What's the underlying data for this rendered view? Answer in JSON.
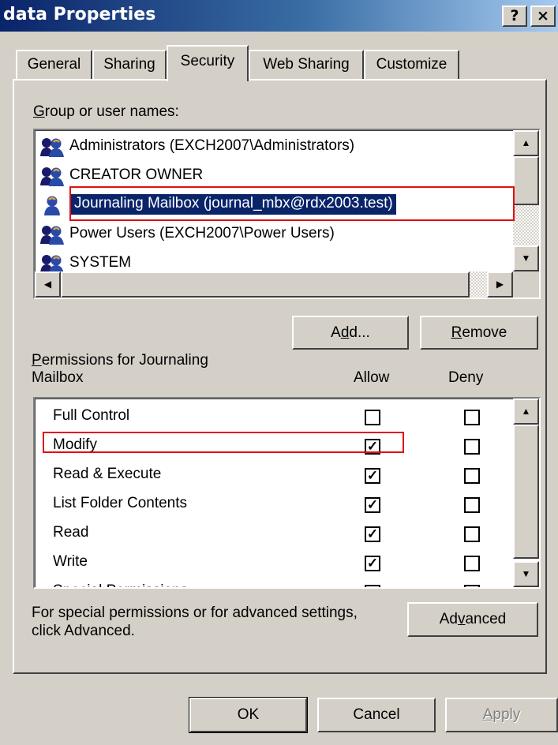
{
  "window": {
    "title": "data Properties",
    "help_btn": "?",
    "close_btn": "×"
  },
  "tabs": [
    {
      "label": "General",
      "active": false
    },
    {
      "label": "Sharing",
      "active": false
    },
    {
      "label": "Security",
      "active": true
    },
    {
      "label": "Web Sharing",
      "active": false
    },
    {
      "label": "Customize",
      "active": false
    }
  ],
  "groups": {
    "label_access_key": "G",
    "label_rest": "roup or user names:",
    "items": [
      {
        "name": "Administrators (EXCH2007\\Administrators)",
        "icon": "group-users-icon",
        "selected": false
      },
      {
        "name": "CREATOR OWNER",
        "icon": "group-users-icon",
        "selected": false
      },
      {
        "name": "Journaling Mailbox (journal_mbx@rdx2003.test)",
        "icon": "single-user-icon",
        "selected": true
      },
      {
        "name": "Power Users (EXCH2007\\Power Users)",
        "icon": "group-users-icon",
        "selected": false
      },
      {
        "name": "SYSTEM",
        "icon": "group-users-icon",
        "selected": false
      }
    ]
  },
  "buttons": {
    "add_pre": "A",
    "add_key": "d",
    "add_post": "d...",
    "remove_key": "R",
    "remove_post": "emove",
    "advanced_pre": "Ad",
    "advanced_key": "v",
    "advanced_post": "anced",
    "ok": "OK",
    "cancel": "Cancel",
    "apply_key": "A",
    "apply_post": "pply"
  },
  "permissions": {
    "label_key": "P",
    "label_line1_rest": "ermissions for Journaling",
    "label_line2": "Mailbox",
    "col_allow": "Allow",
    "col_deny": "Deny",
    "items": [
      {
        "name": "Full Control",
        "allow": false,
        "deny": false
      },
      {
        "name": "Modify",
        "allow": true,
        "deny": false
      },
      {
        "name": "Read & Execute",
        "allow": true,
        "deny": false
      },
      {
        "name": "List Folder Contents",
        "allow": true,
        "deny": false
      },
      {
        "name": "Read",
        "allow": true,
        "deny": false
      },
      {
        "name": "Write",
        "allow": true,
        "deny": false
      },
      {
        "name": "Special Permissions",
        "allow": false,
        "deny": false
      }
    ]
  },
  "advanced_note": {
    "line1": "For special permissions or for advanced settings,",
    "line2": "click Advanced."
  },
  "colors": {
    "dialog_bg": "#d4d0c8",
    "title_bar": "#0a246a",
    "selection": "#0a246a",
    "highlight_box": "#e01010"
  }
}
